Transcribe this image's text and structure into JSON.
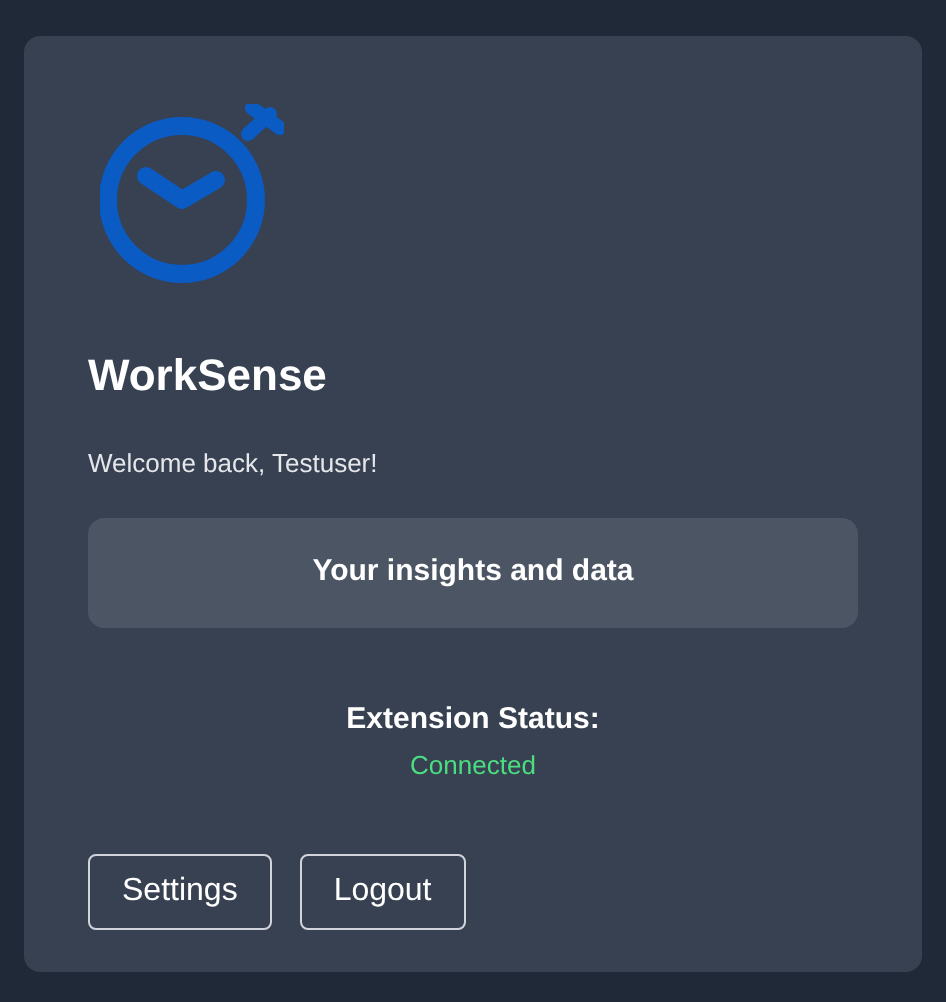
{
  "app": {
    "title": "WorkSense",
    "welcome": "Welcome back, Testuser!"
  },
  "insights_button": {
    "label": "Your insights and data"
  },
  "extension_status": {
    "label": "Extension Status:",
    "value": "Connected",
    "connected": true
  },
  "buttons": [
    {
      "label": "Settings"
    },
    {
      "label": "Logout"
    }
  ]
}
